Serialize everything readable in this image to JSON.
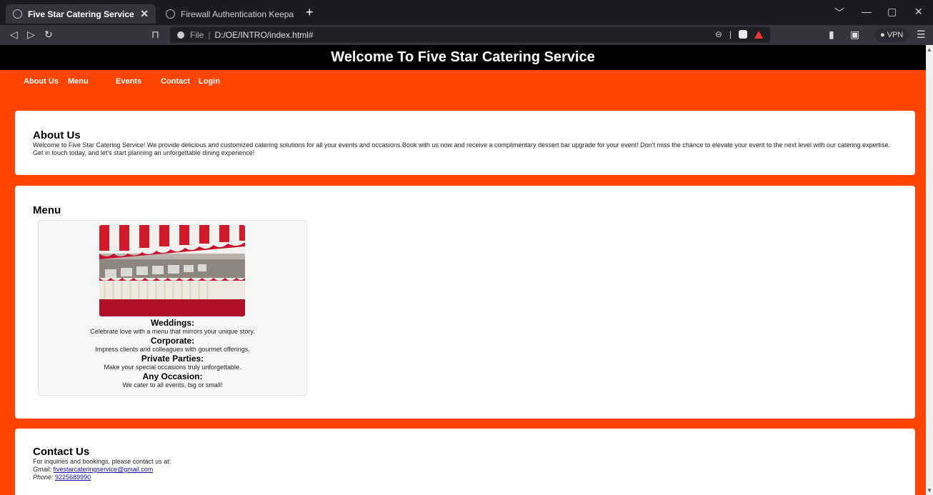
{
  "browser": {
    "tabs": [
      {
        "title": "Five Star Catering Service",
        "active": true
      },
      {
        "title": "Firewall Authentication Keepalive Wind",
        "active": false
      }
    ],
    "address": {
      "scheme_label": "File",
      "url": "D:/OE/INTRO/index.html#"
    },
    "vpn_label": "VPN"
  },
  "site": {
    "header_title": "Welcome To Five Star Catering Service",
    "nav": [
      "About Us",
      "Menu",
      "Events",
      "Contact",
      "Login"
    ]
  },
  "about": {
    "heading": "About Us",
    "text": "Welcome to Five Star Catering Service! We provide delicious and customized catering solutions for all your events and occasions.Book with us now and receive a complimentary dessert bar upgrade for your event! Don't miss the chance to elevate your event to the next level with our catering expertise. Get in touch today, and let's start planning an unforgettable dining experience!"
  },
  "menu": {
    "heading": "Menu",
    "items": [
      {
        "title": "Weddings:",
        "desc": "Celebrate love with a menu that mirrors your unique story."
      },
      {
        "title": "Corporate:",
        "desc": "Impress clients and colleagues with gourmet offerings."
      },
      {
        "title": "Private Parties:",
        "desc": "Make your special occasions truly unforgettable."
      },
      {
        "title": "Any Occasion:",
        "desc": "We cater to all events, big or small!"
      }
    ]
  },
  "contact": {
    "heading": "Contact Us",
    "intro": "For inquiries and bookings, please contact us at:",
    "gmail_label": "Gmail:",
    "gmail": "fivestarcateringservice@gmail.com",
    "phone_label": "Phone:",
    "phone": "9225689990"
  },
  "colors": {
    "brand_orange": "#ff4500",
    "header_black": "#000000",
    "card_white": "#ffffff"
  }
}
